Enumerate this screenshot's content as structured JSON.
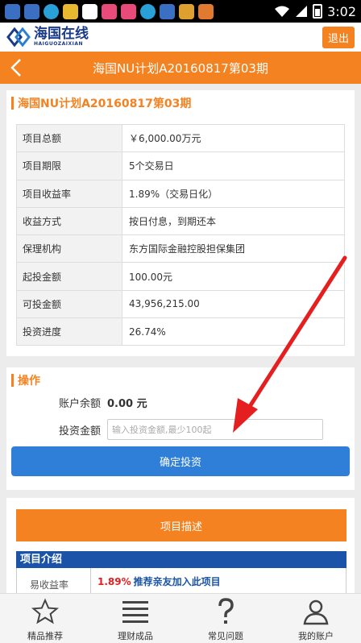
{
  "status_bar": {
    "time": "3:02"
  },
  "brand": {
    "name_cn": "海国在线",
    "name_en": "HAIGUOZAIXIAN",
    "exit_label": "退出"
  },
  "title_bar": {
    "title": "海国NU计划A20160817第03期"
  },
  "project": {
    "section_title": "海国NU计划A20160817第03期",
    "rows": [
      {
        "label": "项目总额",
        "value": "￥6,000.00万元"
      },
      {
        "label": "项目期限",
        "value": "5个交易日"
      },
      {
        "label": "项目收益率",
        "value": "1.89%（交易日化）"
      },
      {
        "label": "收益方式",
        "value": "按日付息，到期还本"
      },
      {
        "label": "保理机构",
        "value": "东方国际金融控股担保集团"
      },
      {
        "label": "起投金额",
        "value": "100.00元"
      },
      {
        "label": "可投金额",
        "value": "43,956,215.00"
      },
      {
        "label": "投资进度",
        "value": "26.74%"
      }
    ]
  },
  "operation": {
    "section_title": "操作",
    "balance_label": "账户余额",
    "balance_value": "0.00 元",
    "amount_label": "投资金额",
    "amount_placeholder": "输入投资金额,最少100起",
    "confirm_label": "确定投资"
  },
  "description": {
    "button_label": "项目描述",
    "intro_title": "项目介绍",
    "row_left": "易收益率",
    "rate": "1.89%",
    "invite": "推荐亲友加入此项目"
  },
  "bottom_nav": [
    {
      "label": "精品推荐",
      "icon": "star-icon"
    },
    {
      "label": "理财成品",
      "icon": "list-icon"
    },
    {
      "label": "常见问题",
      "icon": "question-icon"
    },
    {
      "label": "我的账户",
      "icon": "user-icon"
    }
  ],
  "colors": {
    "accent": "#f58220",
    "brand_blue": "#1a53a8",
    "button_blue": "#2f7fd8",
    "annotation_red": "#e51f1f"
  }
}
